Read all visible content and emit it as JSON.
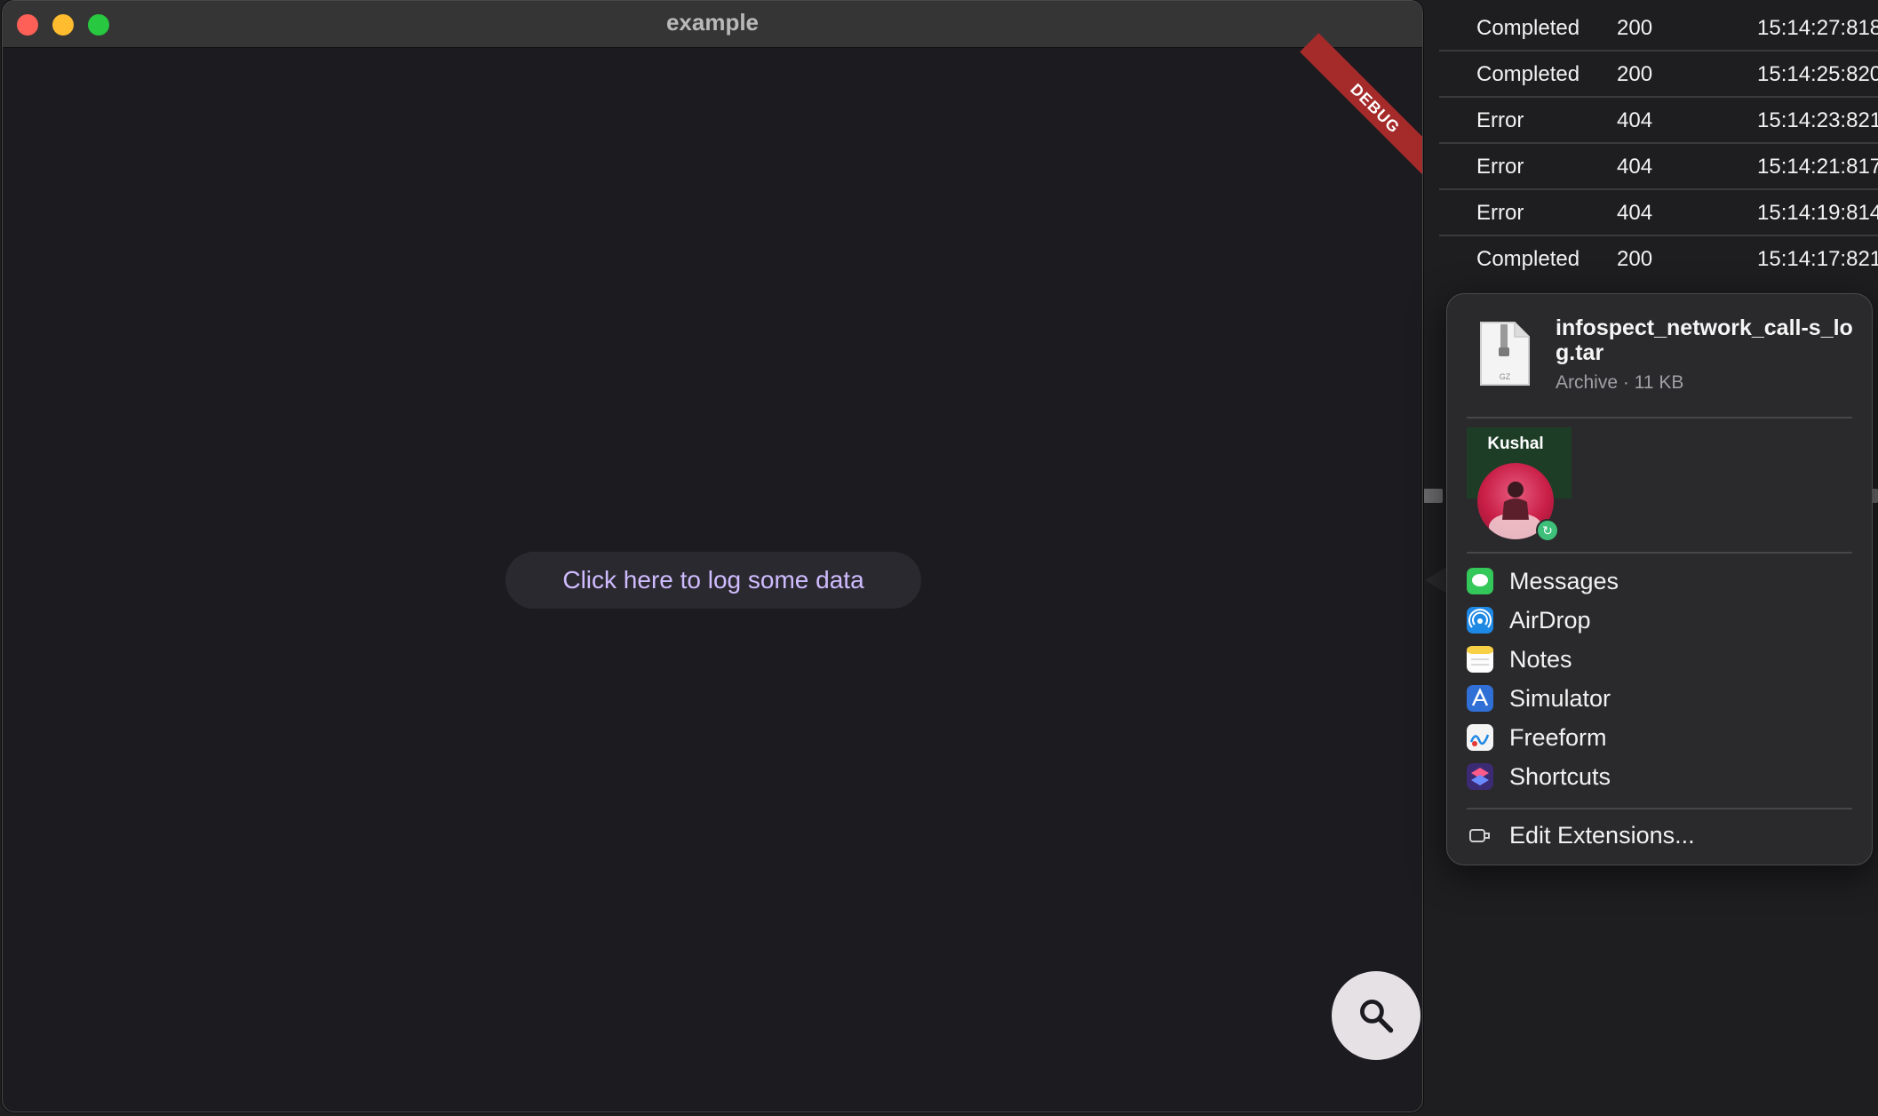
{
  "window": {
    "title": "example",
    "debug_banner": "DEBUG",
    "log_button_label": "Click here to log some data",
    "fab_icon": "search-icon"
  },
  "log_rows": [
    {
      "status": "Completed",
      "code": "200",
      "time": "15:14:27:818"
    },
    {
      "status": "Completed",
      "code": "200",
      "time": "15:14:25:820"
    },
    {
      "status": "Error",
      "code": "404",
      "time": "15:14:23:821"
    },
    {
      "status": "Error",
      "code": "404",
      "time": "15:14:21:817"
    },
    {
      "status": "Error",
      "code": "404",
      "time": "15:14:19:814"
    },
    {
      "status": "Completed",
      "code": "200",
      "time": "15:14:17:821"
    }
  ],
  "share_sheet": {
    "file_name": "infospect_network_call-s_log.tar",
    "file_meta": "Archive · 11 KB",
    "file_icon_label": "GZ",
    "contact_name": "Kushal",
    "apps": [
      {
        "label": "Messages",
        "icon": "messages-icon",
        "color": "#34c759"
      },
      {
        "label": "AirDrop",
        "icon": "airdrop-icon",
        "color": "#1e88e5"
      },
      {
        "label": "Notes",
        "icon": "notes-icon",
        "color": "#f7d046"
      },
      {
        "label": "Simulator",
        "icon": "simulator-icon",
        "color": "#2f6fd6"
      },
      {
        "label": "Freeform",
        "icon": "freeform-icon",
        "color": "#f4f4f4"
      },
      {
        "label": "Shortcuts",
        "icon": "shortcuts-icon",
        "color": "#6a3de8"
      }
    ],
    "edit_extensions_label": "Edit Extensions..."
  }
}
